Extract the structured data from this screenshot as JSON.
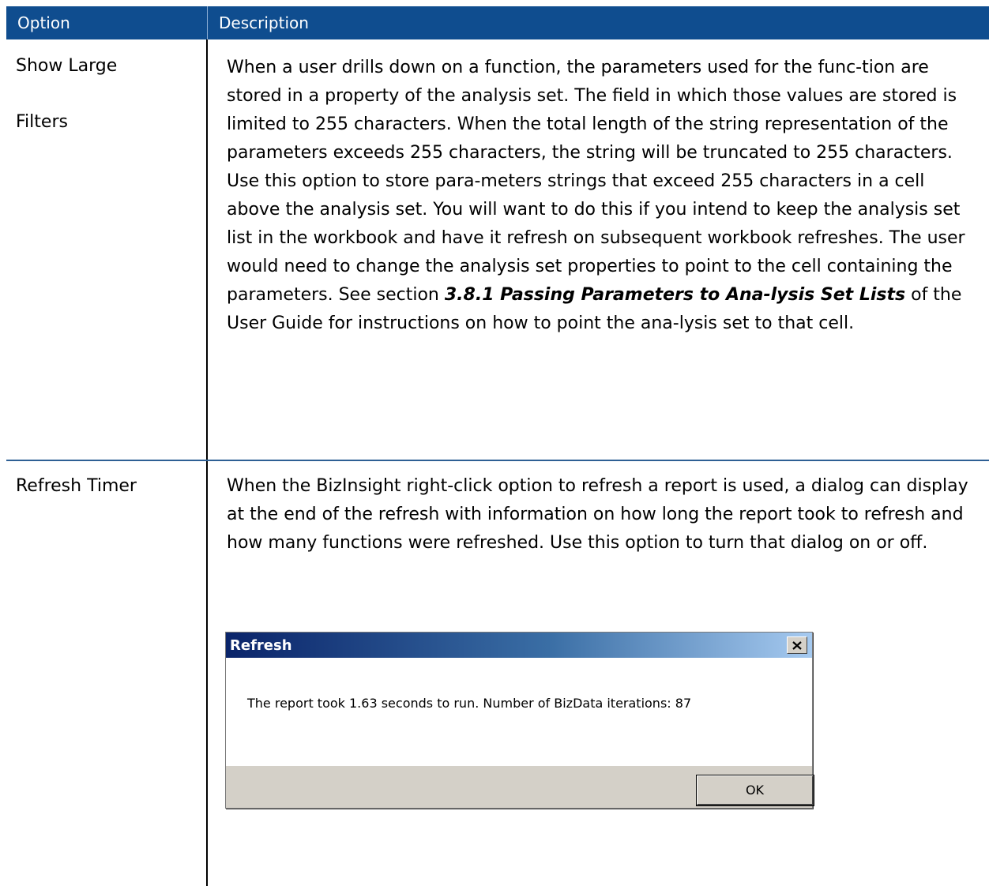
{
  "table": {
    "headers": {
      "option": "Option",
      "description": "Description"
    },
    "rows": [
      {
        "option_line1": "Show Large",
        "option_line2": "Filters",
        "description_part1": "When a user drills down on a function, the parameters used for the func-tion are stored in a property of the analysis set. The field in which those values are stored is limited to 255 characters. When the total length of the string representation of the parameters exceeds 255 characters, the string will be truncated to 255 characters. Use this option to store para-meters strings that exceed 255 characters in a cell above the analysis set. You will want to do this if you intend to keep the analysis set list in the workbook and have it refresh on subsequent workbook refreshes. The user would need to change the analysis set properties to point to the cell containing the parameters. See section ",
        "description_emphasis": "3.8.1 Passing Parameters to Ana-lysis Set Lists",
        "description_part2": " of the User Guide for instructions on how to point the ana-lysis set to that cell."
      },
      {
        "option": "Refresh Timer",
        "description": "When the BizInsight right-click option to refresh a report is used, a dialog can display at the end of the refresh with information on how long the report took to refresh and how many functions were refreshed. Use this option to turn that dialog on or off."
      }
    ]
  },
  "dialog": {
    "title": "Refresh",
    "close_glyph": "✕",
    "message": "The report took 1.63 seconds to run. Number of BizData iterations: 87",
    "ok_label": "OK"
  },
  "colors": {
    "header_bg": "#0f4d8f",
    "title_gradient_start": "#0a246a",
    "title_gradient_end": "#a6caf0",
    "dialog_face": "#d4d0c8"
  }
}
